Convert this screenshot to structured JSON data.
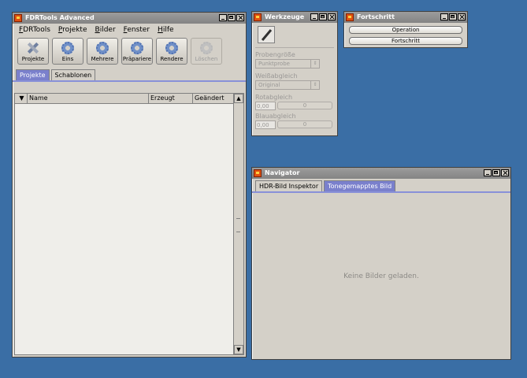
{
  "main_window": {
    "title": "FDRTools Advanced",
    "menu": [
      "FDRTools",
      "Projekte",
      "Bilder",
      "Fenster",
      "Hilfe"
    ],
    "toolbar": [
      {
        "label": "Projekte",
        "icon": "wrench-icon",
        "enabled": true
      },
      {
        "label": "Eins",
        "icon": "gear-icon",
        "enabled": true
      },
      {
        "label": "Mehrere",
        "icon": "gear-icon",
        "enabled": true
      },
      {
        "label": "Präpariere",
        "icon": "gear-icon",
        "enabled": true
      },
      {
        "label": "Rendere",
        "icon": "gear-icon",
        "enabled": true
      },
      {
        "label": "Löschen",
        "icon": "gear-icon",
        "enabled": false
      }
    ],
    "tabs": [
      {
        "label": "Projekte",
        "active": true
      },
      {
        "label": "Schablonen",
        "active": false
      }
    ],
    "columns": [
      "Name",
      "Erzeugt",
      "Geändert"
    ]
  },
  "werkzeuge": {
    "title": "Werkzeuge",
    "probe_label": "Probengröße",
    "probe_value": "Punktprobe",
    "wb_label": "Weißabgleich",
    "wb_value": "Original",
    "red_label": "Rotabgleich",
    "red_value": "0,00",
    "red_slider": "0",
    "blue_label": "Blauabgleich",
    "blue_value": "0,00",
    "blue_slider": "0"
  },
  "fortschritt": {
    "title": "Fortschritt",
    "operation_label": "Operation",
    "progress_label": "Fortschritt"
  },
  "navigator": {
    "title": "Navigator",
    "tabs": [
      {
        "label": "HDR-Bild Inspektor",
        "active": false
      },
      {
        "label": "Tonegemapptes Bild",
        "active": true
      }
    ],
    "empty_message": "Keine Bilder geladen."
  },
  "colors": {
    "desktop": "#3a6ea5",
    "tab_active": "#7a80cc"
  }
}
